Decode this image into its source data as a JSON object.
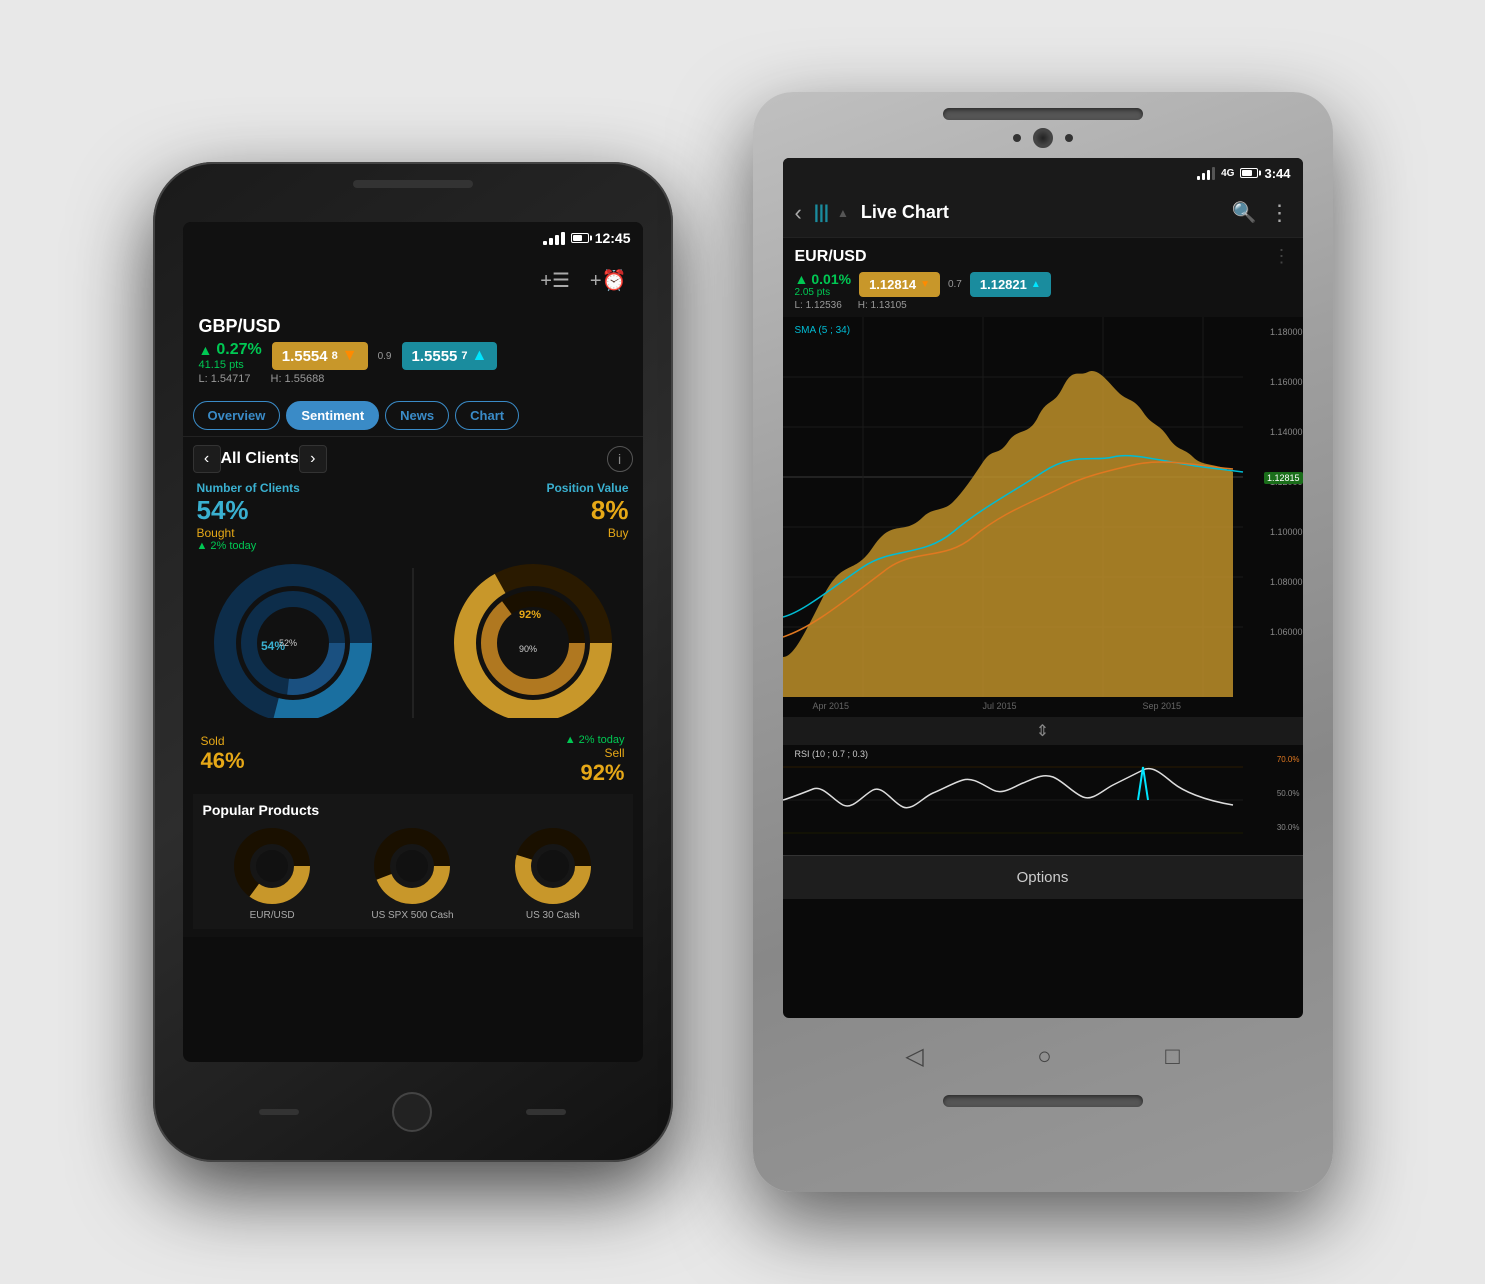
{
  "phone1": {
    "statusbar": {
      "time": "12:45"
    },
    "instrument": {
      "name": "GBP/USD",
      "change_pct": "0.27%",
      "change_pts": "41.15 pts",
      "sell_price": "1.5554",
      "sell_suffix": "8",
      "buy_price": "1.5555",
      "buy_suffix": "7",
      "spread": "0.9",
      "low": "L: 1.54717",
      "high": "H: 1.55688"
    },
    "tabs": [
      "Overview",
      "Sentiment",
      "News",
      "Chart"
    ],
    "active_tab": "Sentiment",
    "sentiment": {
      "title": "All Clients",
      "num_clients_label": "Number of Clients",
      "position_value_label": "Position Value",
      "bought_pct": "54%",
      "bought_label": "Bought",
      "bought_today": "2% today",
      "sold_pct": "46%",
      "sold_label": "Sold",
      "buy_pct": "8%",
      "buy_label": "Buy",
      "sell_pct": "92%",
      "sell_label": "Sell",
      "sell_today": "2% today",
      "inner_pct1": "52%",
      "inner_pct2": "90%",
      "outer_pct1": "54%",
      "outer_pct2": "92%"
    },
    "popular_products": {
      "title": "Popular Products",
      "items": [
        {
          "name": "EUR/USD"
        },
        {
          "name": "US SPX 500\nCash"
        },
        {
          "name": "US 30\nCash"
        }
      ]
    }
  },
  "phone2": {
    "statusbar": {
      "time": "3:44"
    },
    "toolbar": {
      "title": "Live Chart",
      "back_icon": "‹",
      "chart_icon": "|||",
      "search_icon": "🔍",
      "more_icon": "⋮"
    },
    "instrument": {
      "name": "EUR/USD",
      "change_pct": "0.01%",
      "change_pts": "2.05 pts",
      "sell_price": "1.12814",
      "sell_suffix": "",
      "buy_price": "1.12821",
      "buy_suffix": "",
      "spread": "0.7",
      "low": "L: 1.12536",
      "high": "H: 1.13105",
      "current": "1.12815"
    },
    "chart": {
      "sma_label": "SMA (5 ; 34)",
      "date_labels": [
        "Apr 2015",
        "Jul 2015",
        "Sep 2015"
      ],
      "price_levels": [
        "1.18000",
        "1.16000",
        "1.14000",
        "1.12000",
        "1.10000",
        "1.08000",
        "1.06000"
      ],
      "rsi_label": "RSI (10 ; 0.7 ; 0.3)",
      "rsi_levels": [
        "70.0%",
        "50.0%",
        "30.0%"
      ]
    },
    "options_bar": {
      "label": "Options"
    }
  }
}
